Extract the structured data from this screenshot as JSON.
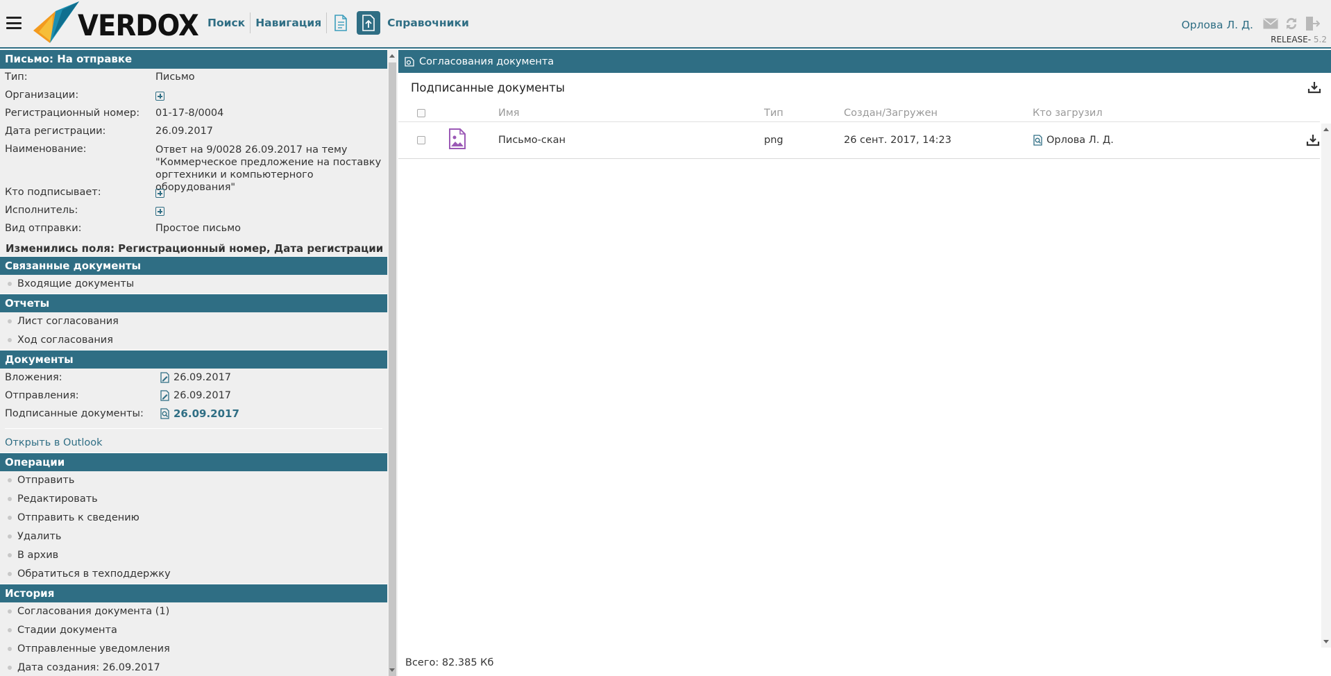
{
  "app": {
    "logo_text": "VERDOX",
    "nav": {
      "search": "Поиск",
      "navigation": "Навигация",
      "directories": "Справочники"
    },
    "user": {
      "name": "Орлова Л. Д."
    },
    "release": {
      "label": "RELEASE-",
      "version": "5.2"
    }
  },
  "left": {
    "header": "Письмо: На отправке",
    "fields": [
      {
        "label": "Тип:",
        "value": "Письмо"
      },
      {
        "label": "Организации:",
        "value": ""
      },
      {
        "label": "Регистрационный номер:",
        "value": "01-17-8/0004"
      },
      {
        "label": "Дата регистрации:",
        "value": "26.09.2017"
      },
      {
        "label": "Наименование:",
        "value": "Ответ на 9/0028 26.09.2017 на тему \"Коммерческое предложение на поставку оргтехники и компьютерного оборудования\""
      },
      {
        "label": "Кто подписывает:",
        "value": ""
      },
      {
        "label": "Исполнитель:",
        "value": ""
      },
      {
        "label": "Вид отправки:",
        "value": "Простое письмо"
      }
    ],
    "changed": "Изменились поля: Регистрационный номер, Дата регистрации",
    "related": {
      "title": "Связанные документы",
      "items": [
        "Входящие документы"
      ]
    },
    "reports": {
      "title": "Отчеты",
      "items": [
        "Лист согласования",
        "Ход согласования"
      ]
    },
    "documents": {
      "title": "Документы",
      "rows": [
        {
          "label": "Вложения:",
          "value": "26.09.2017"
        },
        {
          "label": "Отправления:",
          "value": "26.09.2017"
        },
        {
          "label": "Подписанные документы:",
          "value": "26.09.2017"
        }
      ]
    },
    "outlook": "Открыть в Outlook",
    "operations": {
      "title": "Операции",
      "items": [
        "Отправить",
        "Редактировать",
        "Отправить к сведению",
        "Удалить",
        "В архив",
        "Обратиться в техподдержку"
      ]
    },
    "history": {
      "title": "История",
      "items": [
        "Согласования документа (1)",
        "Стадии документа",
        "Отправленные уведомления",
        "Дата создания: 26.09.2017"
      ]
    }
  },
  "right": {
    "header": "Согласования документа",
    "subtitle": "Подписанные документы",
    "columns": {
      "name": "Имя",
      "type": "Тип",
      "created": "Создан/Загружен",
      "uploader": "Кто загрузил"
    },
    "rows": [
      {
        "name": "Письмо-скан",
        "type": "png",
        "created": "26 сент. 2017, 14:23",
        "uploader": "Орлова Л. Д."
      }
    ],
    "total": "Всего: 82.385 Кб"
  },
  "colors": {
    "accent": "#2f6e84",
    "panel_bg": "#efefef",
    "file_icon": "#9b59b6"
  }
}
